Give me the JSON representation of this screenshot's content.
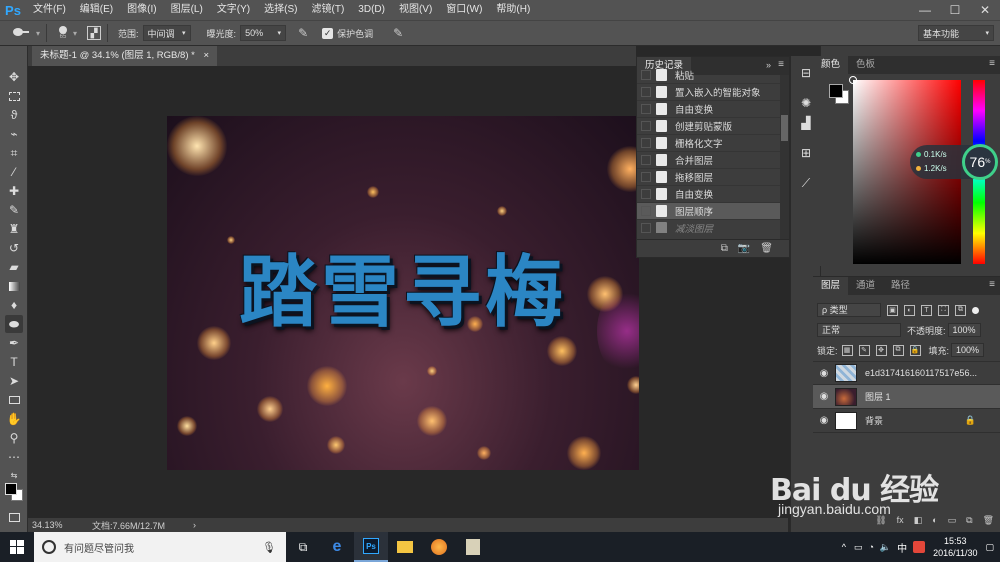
{
  "app": {
    "logo": "Ps"
  },
  "menu": [
    "文件(F)",
    "编辑(E)",
    "图像(I)",
    "图层(L)",
    "文字(Y)",
    "选择(S)",
    "滤镜(T)",
    "3D(D)",
    "视图(V)",
    "窗口(W)",
    "帮助(H)"
  ],
  "window_controls": {
    "minimize": "—",
    "maximize": "☐",
    "close": "✕"
  },
  "options": {
    "brush_size": "65",
    "range_label": "范围:",
    "range_value": "中间调",
    "exposure_label": "曝光度:",
    "exposure_value": "50%",
    "protect_tone_label": "保护色调",
    "protect_tone_checked": "✓",
    "workspace": "基本功能"
  },
  "document": {
    "tab_title": "未标题-1 @ 34.1% (图层 1, RGB/8) *",
    "tab_close": "×",
    "headline": "踏雪寻梅"
  },
  "status": {
    "zoom": "34.13%",
    "doc_size": "文档:7.66M/12.7M"
  },
  "history": {
    "title": "历史记录",
    "items": [
      {
        "label": "粘贴",
        "state": "cut"
      },
      {
        "label": "置入嵌入的智能对象",
        "state": "normal"
      },
      {
        "label": "自由变换",
        "state": "normal"
      },
      {
        "label": "创建剪贴蒙版",
        "state": "normal"
      },
      {
        "label": "栅格化文字",
        "state": "normal"
      },
      {
        "label": "合并图层",
        "state": "normal"
      },
      {
        "label": "拖移图层",
        "state": "normal"
      },
      {
        "label": "自由变换",
        "state": "normal"
      },
      {
        "label": "图层顺序",
        "state": "selected"
      },
      {
        "label": "减淡图层",
        "state": "dim"
      }
    ]
  },
  "color_panel": {
    "tabs": [
      "颜色",
      "色板"
    ]
  },
  "net_widget": {
    "up": "0.1K/s",
    "down": "1.2K/s",
    "percent": "76",
    "percent_sign": "%"
  },
  "layers": {
    "tabs": [
      "图层",
      "通道",
      "路径"
    ],
    "filter_kind": "ρ 类型",
    "blend_mode": "正常",
    "opacity_label": "不透明度:",
    "opacity_value": "100%",
    "lock_label": "锁定:",
    "fill_label": "填充:",
    "fill_value": "100%",
    "items": [
      {
        "name": "e1d317416160117517e56...",
        "selected": false
      },
      {
        "name": "图层 1",
        "selected": true
      },
      {
        "name": "背景",
        "selected": false
      }
    ]
  },
  "taskbar": {
    "search_placeholder": "有问题尽管问我",
    "time": "15:53",
    "date": "2016/11/30",
    "ime": "中"
  },
  "watermark": {
    "logo": "Bai du 经验",
    "url": "jingyan.baidu.com"
  }
}
